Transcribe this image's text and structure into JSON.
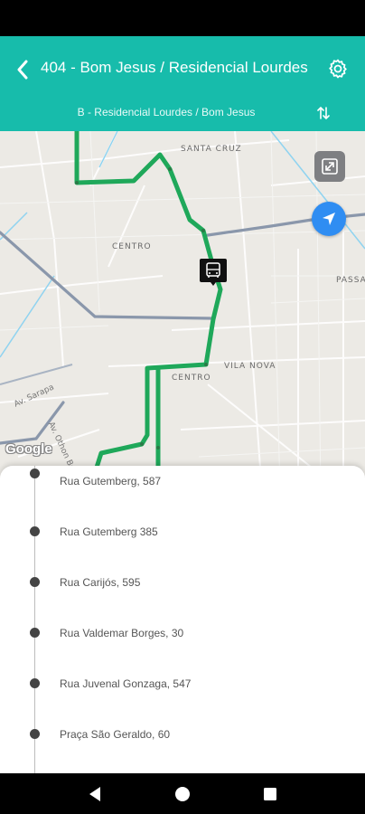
{
  "app_bar": {
    "title": "404 - Bom Jesus / Residencial Lourdes",
    "direction": "B - Residencial Lourdes / Bom Jesus",
    "background": "#17bcab"
  },
  "icons": {
    "back": "chevron-left-icon",
    "settings": "gear-icon",
    "swap": "swap-vertical-icon",
    "expand": "expand-icon",
    "locate": "navigation-arrow-icon",
    "bus": "bus-icon"
  },
  "map": {
    "labels": {
      "santa_cruz": "SANTA CRUZ",
      "centro_top": "CENTRO",
      "centro_bottom": "CENTRO",
      "vila_nova": "VILA NOVA",
      "passa": "PASSA"
    },
    "streets": {
      "av_sarapa": "Av. Sarapa",
      "av_othon": "Av. Othon Bezerra de Melo"
    },
    "attribution": "Google",
    "route_color": "#1fa85a"
  },
  "stops": [
    {
      "label": "Rua Gutemberg, 587"
    },
    {
      "label": "Rua Gutemberg 385"
    },
    {
      "label": "Rua Carijós, 595"
    },
    {
      "label": "Rua Valdemar Borges, 30"
    },
    {
      "label": "Rua Juvenal Gonzaga, 547"
    },
    {
      "label": "Praça São Geraldo, 60"
    }
  ],
  "nav": {
    "back": "back-triangle-icon",
    "home": "home-circle-icon",
    "recents": "recents-square-icon"
  }
}
